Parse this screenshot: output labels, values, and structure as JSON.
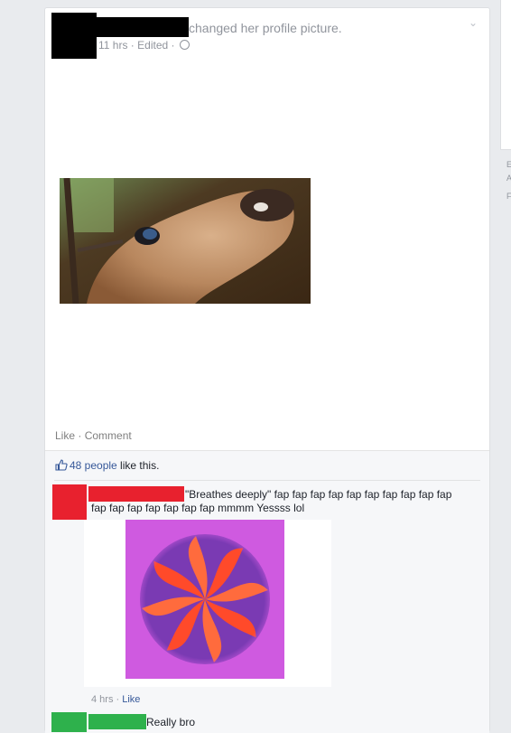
{
  "post": {
    "action_text": "changed her profile picture.",
    "time": "11 hrs",
    "edited": "Edited",
    "separator": " · ",
    "actions": {
      "like": "Like",
      "comment": "Comment"
    }
  },
  "likes": {
    "count": "48 people",
    "suffix": " like this."
  },
  "comments": [
    {
      "text": "\"Breathes deeply\" fap fap fap fap fap fap fap fap fap fap fap fap fap fap fap fap fap mmmm Yessss lol",
      "time": "4 hrs",
      "like": "Like"
    },
    {
      "text": "Really bro"
    }
  ],
  "colors": {
    "redaction_black": "#000000",
    "redaction_red": "#e8212e",
    "redaction_green": "#2eb14c",
    "link_blue": "#365899",
    "meta_gray": "#90949c"
  },
  "icons": {
    "privacy": "globe-icon",
    "options": "chevron-down-icon",
    "like": "thumbs-up-icon"
  }
}
